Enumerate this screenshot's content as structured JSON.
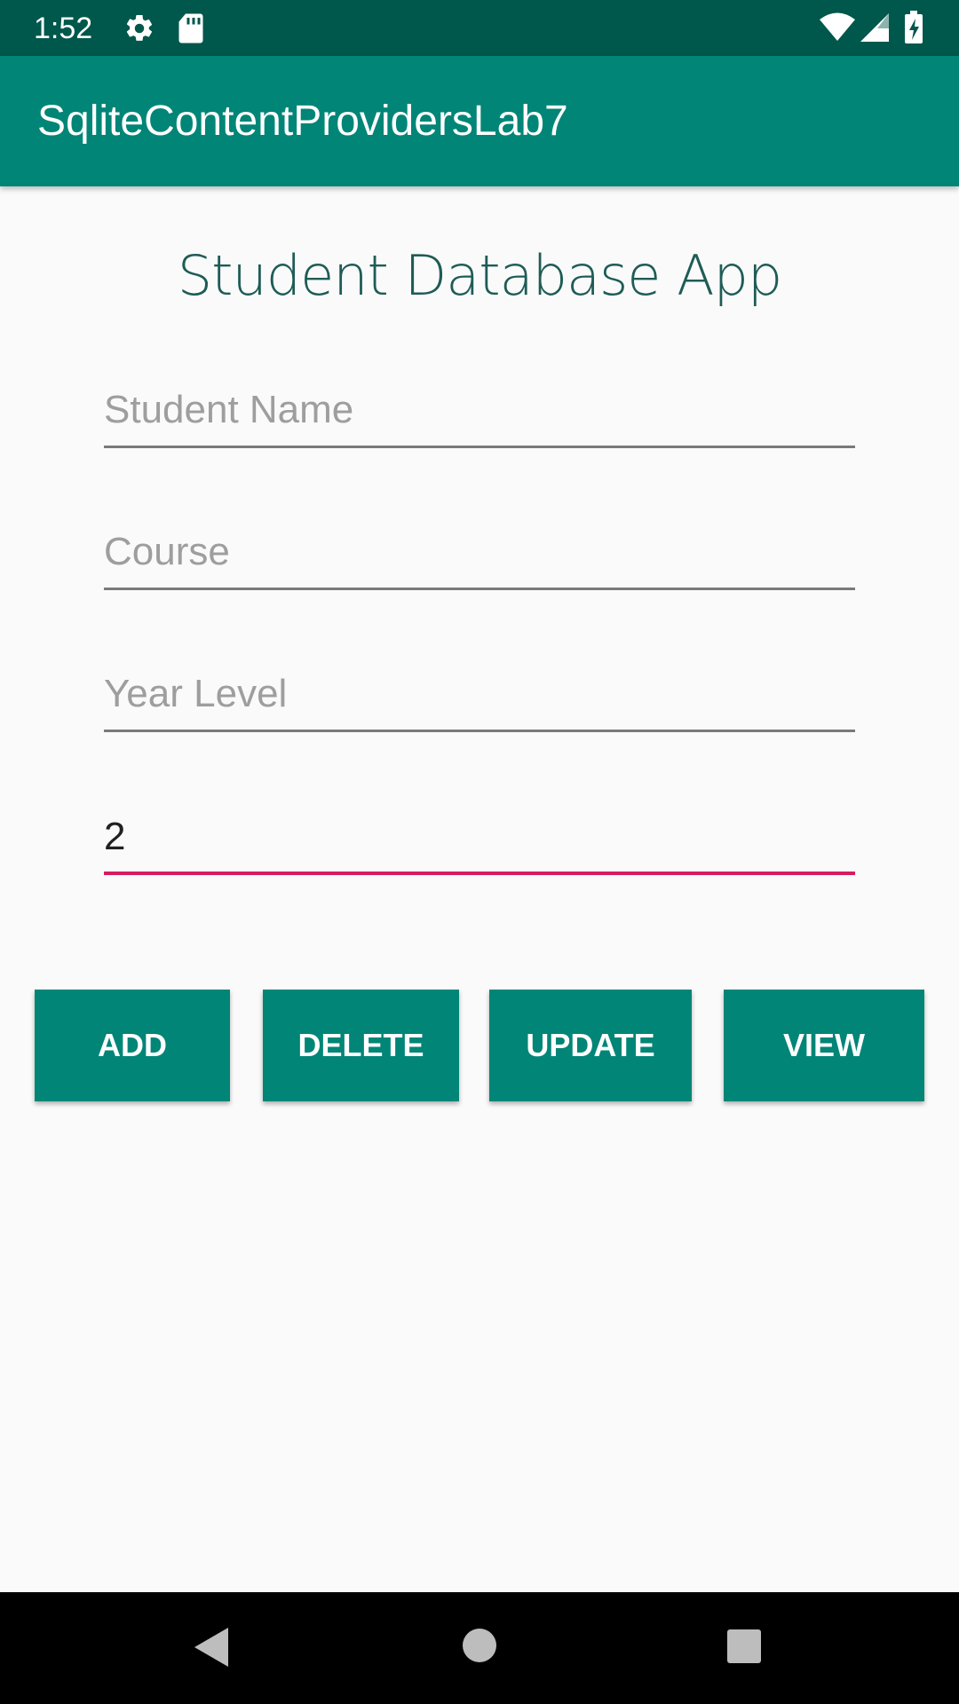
{
  "status_bar": {
    "time": "1:52",
    "icons": [
      "gear-icon",
      "sd-card-icon",
      "wifi-icon",
      "signal-icon",
      "battery-charging-icon"
    ]
  },
  "app_bar": {
    "title": "SqliteContentProvidersLab7"
  },
  "main": {
    "heading": "Student Database App",
    "fields": {
      "student_name": {
        "value": "",
        "placeholder": "Student Name"
      },
      "course": {
        "value": "",
        "placeholder": "Course"
      },
      "year_level": {
        "value": "",
        "placeholder": "Year Level"
      },
      "id": {
        "value": "2",
        "placeholder": ""
      }
    },
    "buttons": {
      "add": "ADD",
      "delete": "DELETE",
      "update": "UPDATE",
      "view": "VIEW"
    }
  },
  "nav_bar": {
    "icons": [
      "back-icon",
      "home-icon",
      "recents-icon"
    ]
  },
  "colors": {
    "primary": "#008577",
    "primary_dark": "#00574b",
    "accent": "#d81b60"
  }
}
